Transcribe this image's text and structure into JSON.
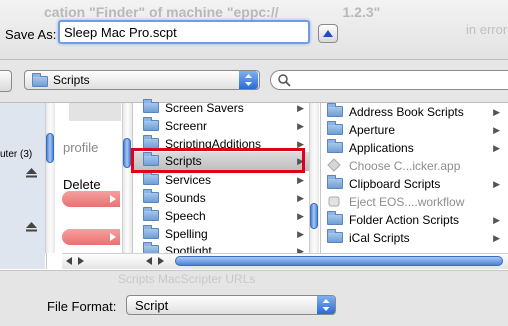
{
  "ghost_text": "cation \"Finder\" of machine \"eppc://",
  "ghost_numbers": "1.2.3\"",
  "ghost_right": "in error",
  "save_as": {
    "label": "Save As:",
    "value": "Sleep Mac Pro.scpt"
  },
  "location": {
    "selected": "Scripts"
  },
  "sidebar": {
    "computer_label": "uter (3)"
  },
  "column1": {
    "profile_label": "profile",
    "delete_label": "Delete"
  },
  "column2": {
    "items": [
      {
        "label": "Screen Savers"
      },
      {
        "label": "Screenr"
      },
      {
        "label": "ScriptingAdditions"
      },
      {
        "label": "Scripts",
        "selected": true
      },
      {
        "label": "Services"
      },
      {
        "label": "Sounds"
      },
      {
        "label": "Speech"
      },
      {
        "label": "Spelling"
      },
      {
        "label": "Spotlight"
      }
    ]
  },
  "column3": {
    "items": [
      {
        "label": "Address Book Scripts",
        "kind": "folder"
      },
      {
        "label": "Aperture",
        "kind": "folder"
      },
      {
        "label": "Applications",
        "kind": "folder"
      },
      {
        "label": "Choose C...icker.app",
        "kind": "app"
      },
      {
        "label": "Clipboard Scripts",
        "kind": "folder"
      },
      {
        "label": "Eject EOS....workflow",
        "kind": "app"
      },
      {
        "label": "Folder Action Scripts",
        "kind": "folder"
      },
      {
        "label": "iCal Scripts",
        "kind": "folder"
      }
    ]
  },
  "bottom_ghost": "Scripts     MacScripter URLs",
  "file_format": {
    "label": "File Format:",
    "value": "Script"
  },
  "colors": {
    "accent": "#3a7be0",
    "highlight": "#e0001b"
  }
}
